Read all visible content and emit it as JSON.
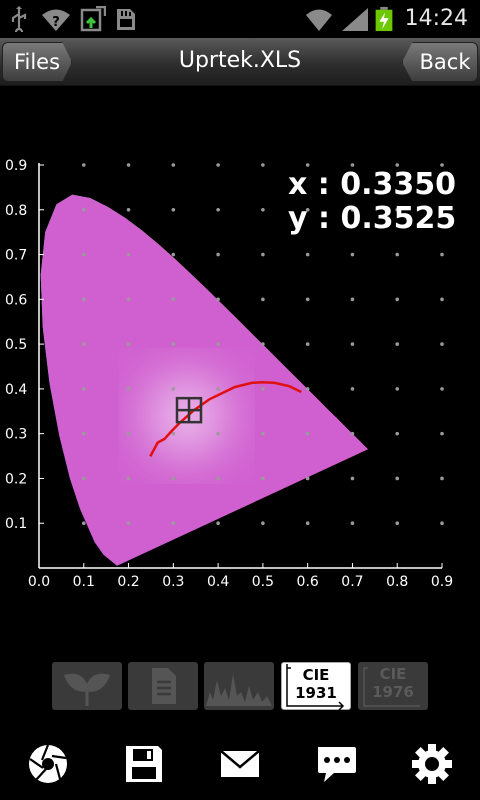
{
  "status_bar": {
    "time": "14:24",
    "icons": [
      "usb-icon",
      "wifi-question-icon",
      "upload-icon",
      "sd-card-icon",
      "wifi-icon",
      "signal-icon",
      "battery-charging-icon"
    ]
  },
  "titlebar": {
    "title": "Uprtek.XLS",
    "left_button": "Files",
    "right_button": "Back"
  },
  "readout": {
    "x_text": "x : 0.3350",
    "y_text": "y : 0.3525"
  },
  "chart_data": {
    "type": "scatter",
    "title": "",
    "xlabel": "",
    "ylabel": "",
    "xlim": [
      0.0,
      0.9
    ],
    "ylim": [
      0.0,
      0.9
    ],
    "x_ticks": [
      "0.0",
      "0.1",
      "0.2",
      "0.3",
      "0.4",
      "0.5",
      "0.6",
      "0.7",
      "0.8",
      "0.9"
    ],
    "y_ticks": [
      "0.1",
      "0.2",
      "0.3",
      "0.4",
      "0.5",
      "0.6",
      "0.7",
      "0.8",
      "0.9"
    ],
    "grid": "dotted",
    "measured_point": {
      "x": 0.335,
      "y": 0.3525
    },
    "spectral_locus": [
      [
        0.1741,
        0.005
      ],
      [
        0.144,
        0.0297
      ],
      [
        0.1241,
        0.0578
      ],
      [
        0.0913,
        0.1327
      ],
      [
        0.0687,
        0.2007
      ],
      [
        0.0454,
        0.295
      ],
      [
        0.0235,
        0.4127
      ],
      [
        0.0082,
        0.5384
      ],
      [
        0.0039,
        0.6548
      ],
      [
        0.0139,
        0.7502
      ],
      [
        0.0389,
        0.812
      ],
      [
        0.0743,
        0.8338
      ],
      [
        0.1142,
        0.8262
      ],
      [
        0.1547,
        0.8059
      ],
      [
        0.1929,
        0.7816
      ],
      [
        0.2296,
        0.7543
      ],
      [
        0.2658,
        0.7243
      ],
      [
        0.3016,
        0.6923
      ],
      [
        0.3373,
        0.6589
      ],
      [
        0.3731,
        0.6245
      ],
      [
        0.4087,
        0.5896
      ],
      [
        0.4441,
        0.5547
      ],
      [
        0.4788,
        0.5202
      ],
      [
        0.5125,
        0.4866
      ],
      [
        0.5448,
        0.4544
      ],
      [
        0.5752,
        0.4242
      ],
      [
        0.6029,
        0.3965
      ],
      [
        0.627,
        0.3725
      ],
      [
        0.6482,
        0.3514
      ],
      [
        0.6658,
        0.334
      ],
      [
        0.6915,
        0.3083
      ],
      [
        0.7079,
        0.292
      ],
      [
        0.7347,
        0.2653
      ]
    ],
    "planckian_locus": [
      [
        0.2485,
        0.2492
      ],
      [
        0.265,
        0.28
      ],
      [
        0.2806,
        0.2883
      ],
      [
        0.2952,
        0.3048
      ],
      [
        0.3135,
        0.3236
      ],
      [
        0.3333,
        0.341
      ],
      [
        0.3459,
        0.3523
      ],
      [
        0.3805,
        0.3768
      ],
      [
        0.412,
        0.392
      ],
      [
        0.4369,
        0.4041
      ],
      [
        0.4762,
        0.4137
      ],
      [
        0.5,
        0.415
      ],
      [
        0.5267,
        0.4133
      ],
      [
        0.559,
        0.406
      ],
      [
        0.5857,
        0.3931
      ]
    ],
    "colors": {
      "axis": "#ffffff",
      "grid_dot": "#9a9a9a",
      "planckian": "#e01010",
      "marker": "#333333"
    }
  },
  "modes": [
    {
      "name": "plant-mode-button",
      "icon": "leaf-icon",
      "active": false
    },
    {
      "name": "document-mode-button",
      "icon": "document-icon",
      "active": false
    },
    {
      "name": "spectrum-mode-button",
      "icon": "spectrum-icon",
      "active": false
    },
    {
      "name": "cie1931-mode-button",
      "line1": "CIE",
      "line2": "1931",
      "active": true
    },
    {
      "name": "cie1976-mode-button",
      "line1": "CIE",
      "line2": "1976",
      "active": false
    }
  ],
  "bottom_bar": [
    "shutter-icon",
    "save-icon",
    "mail-icon",
    "chat-icon",
    "settings-icon"
  ]
}
